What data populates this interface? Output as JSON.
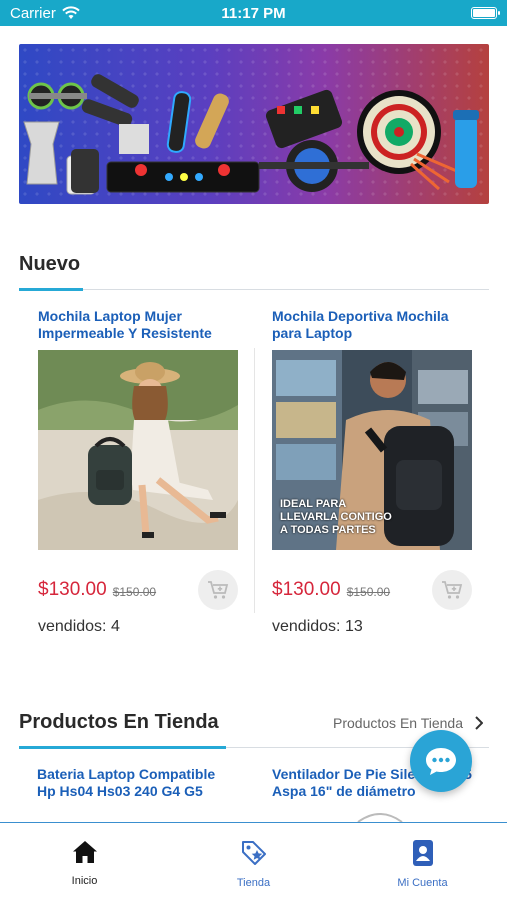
{
  "status_bar": {
    "carrier": "Carrier",
    "time": "11:17 PM"
  },
  "sections": {
    "new": {
      "title": "Nuevo"
    },
    "store": {
      "title": "Productos En Tienda",
      "see_all": "Productos En Tienda"
    }
  },
  "new_products": [
    {
      "title": "Mochila Laptop Mujer Impermeable Y Resistente",
      "price": "$130.00",
      "old_price": "$150.00",
      "sold": "vendidos: 4"
    },
    {
      "title": "Mochila Deportiva Mochila para Laptop",
      "price": "$130.00",
      "old_price": "$150.00",
      "sold": "vendidos: 13",
      "image_caption": [
        "IDEAL PARA",
        "LLEVARLA CONTIGO",
        "A TODAS PARTES"
      ]
    }
  ],
  "store_products": [
    {
      "title": "Bateria Laptop Compatible Hp Hs04 Hs03 240 G4 G5"
    },
    {
      "title": "Ventilador De Pie Silencioso 5 Aspa 16\" de diámetro"
    }
  ],
  "bottom_nav": [
    {
      "label": "Inicio",
      "icon": "home-icon",
      "active": true
    },
    {
      "label": "Tienda",
      "icon": "tag-icon",
      "active": false
    },
    {
      "label": "Mi Cuenta",
      "icon": "account-icon",
      "active": false
    }
  ],
  "colors": {
    "accent": "#26a9d6",
    "status_bar": "#18a8c9",
    "title_blue": "#1b5fb8",
    "price_red": "#d6263b"
  }
}
